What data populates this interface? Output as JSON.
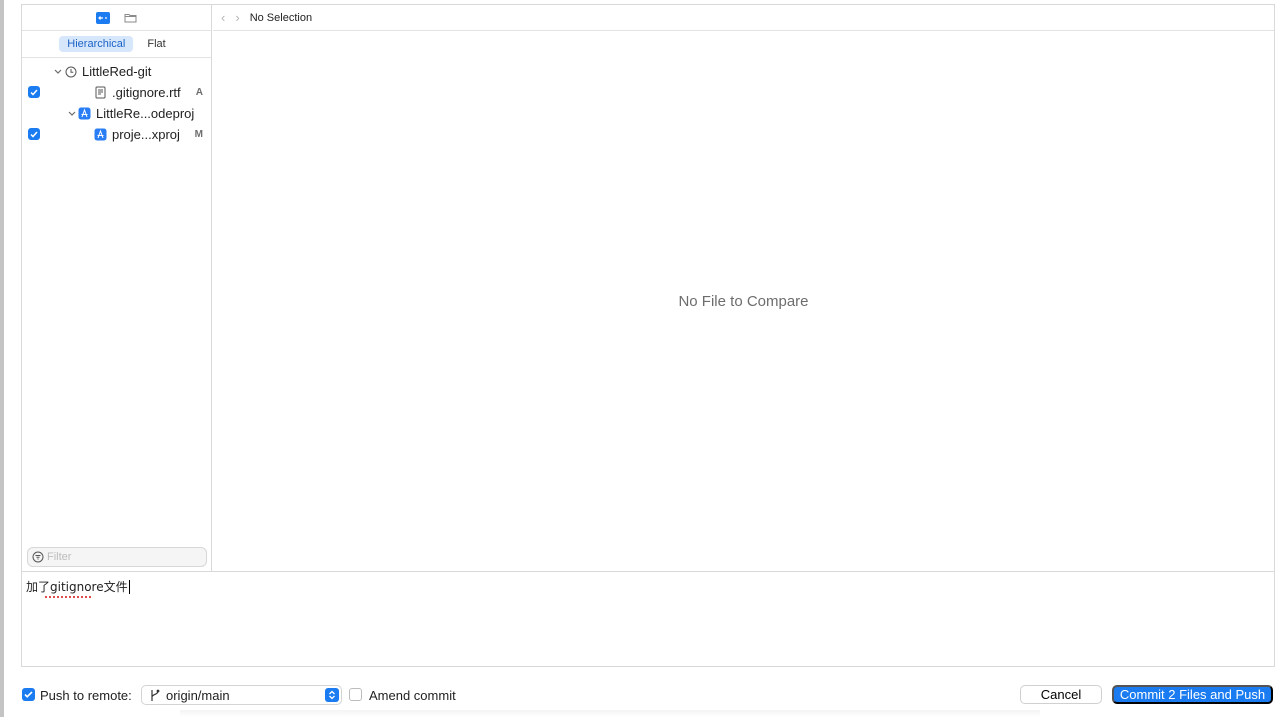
{
  "sidebar": {
    "view_modes": [
      {
        "label": "Hierarchical",
        "active": true
      },
      {
        "label": "Flat",
        "active": false
      }
    ],
    "tree": {
      "root": {
        "label": "LittleRed-git",
        "icon": "clock-icon"
      },
      "items": [
        {
          "label": ".gitignore.rtf",
          "status": "A",
          "checked": true,
          "icon": "document-icon"
        },
        {
          "label": "LittleRe...odeproj",
          "status": "",
          "checked": false,
          "icon": "xcode-project-icon"
        },
        {
          "label": "proje...xproj",
          "status": "M",
          "checked": true,
          "icon": "xcode-project-icon"
        }
      ]
    },
    "filter_placeholder": "Filter"
  },
  "main": {
    "path_title": "No Selection",
    "empty_message": "No File to Compare"
  },
  "commit_message": "加了gitignore文件",
  "bottom_bar": {
    "push_checked": true,
    "push_label": "Push to remote:",
    "branch": "origin/main",
    "amend_checked": false,
    "amend_label": "Amend commit",
    "cancel_label": "Cancel",
    "commit_label": "Commit 2 Files and Push"
  },
  "colors": {
    "accent": "#1a7cf0"
  }
}
